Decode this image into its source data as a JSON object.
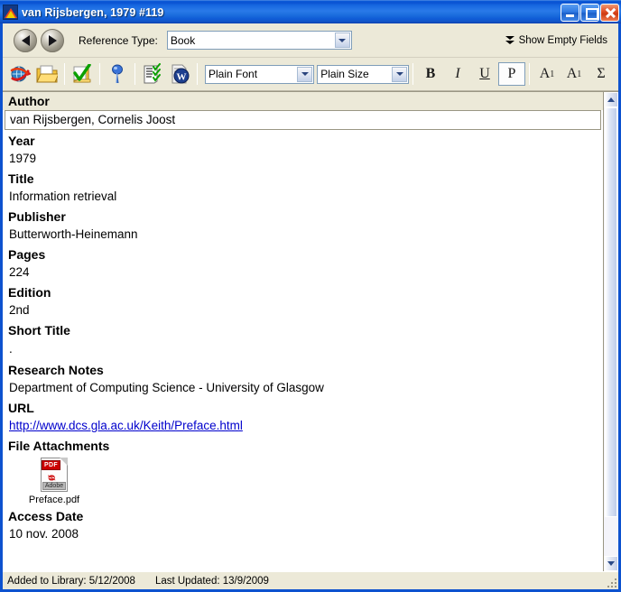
{
  "window": {
    "title": "van Rijsbergen, 1979 #119",
    "icon": "endnote-app-icon",
    "minimize_label": "Minimize",
    "maximize_label": "Maximize",
    "close_label": "Close"
  },
  "reference_bar": {
    "back_label": "Previous Reference",
    "forward_label": "Next Reference",
    "reference_type_label": "Reference Type:",
    "reference_type_value": "Book",
    "show_empty_fields": "Show Empty Fields"
  },
  "toolbar": {
    "buttons": [
      {
        "name": "open-link-icon",
        "label": "Open Link"
      },
      {
        "name": "open-file-icon",
        "label": "Open File"
      },
      {
        "name": "spell-check-icon",
        "label": "Spell Check"
      },
      {
        "name": "insert-pin-icon",
        "label": "Mark as Read"
      },
      {
        "name": "insert-citation-icon",
        "label": "Insert Citation"
      },
      {
        "name": "word-export-icon",
        "label": "Export to Word"
      }
    ],
    "font_select": "Plain Font",
    "size_select": "Plain Size",
    "format_buttons": [
      {
        "name": "bold-button",
        "label": "B",
        "active": false
      },
      {
        "name": "italic-button",
        "label": "I",
        "active": false
      },
      {
        "name": "underline-button",
        "label": "U",
        "active": false
      },
      {
        "name": "plain-button",
        "label": "P",
        "active": true
      },
      {
        "name": "superscript-button",
        "label": "A",
        "sup": "1",
        "active": false
      },
      {
        "name": "subscript-button",
        "label": "A",
        "sub": "1",
        "active": false
      },
      {
        "name": "symbol-button",
        "label": "Σ",
        "active": false
      }
    ]
  },
  "fields": {
    "author": {
      "label": "Author",
      "value": "van Rijsbergen, Cornelis Joost"
    },
    "year": {
      "label": "Year",
      "value": "1979"
    },
    "title": {
      "label": "Title",
      "value": "Information retrieval"
    },
    "publisher": {
      "label": "Publisher",
      "value": "Butterworth-Heinemann"
    },
    "pages": {
      "label": "Pages",
      "value": "224"
    },
    "edition": {
      "label": "Edition",
      "value": "2nd"
    },
    "short_title": {
      "label": "Short Title",
      "value": "."
    },
    "research_notes": {
      "label": "Research Notes",
      "value": "Department of Computing Science - University of Glasgow"
    },
    "url": {
      "label": "URL",
      "value": "http://www.dcs.gla.ac.uk/Keith/Preface.html"
    },
    "file_attachments": {
      "label": "File Attachments",
      "items": [
        {
          "name": "Preface.pdf",
          "icon": "pdf-file-icon"
        }
      ]
    },
    "access_date": {
      "label": "Access Date",
      "value": "10 nov. 2008"
    }
  },
  "scrollbar": {
    "up_label": "Scroll Up",
    "down_label": "Scroll Down"
  },
  "status": {
    "added": "Added to Library: 5/12/2008",
    "updated": "Last Updated: 13/9/2009"
  },
  "colors": {
    "titlebar_blue": "#0a52d2",
    "frame_blue": "#0d52cf",
    "chrome_beige": "#ece9d8",
    "link_blue": "#0000cc",
    "pdf_red": "#cc0000"
  }
}
